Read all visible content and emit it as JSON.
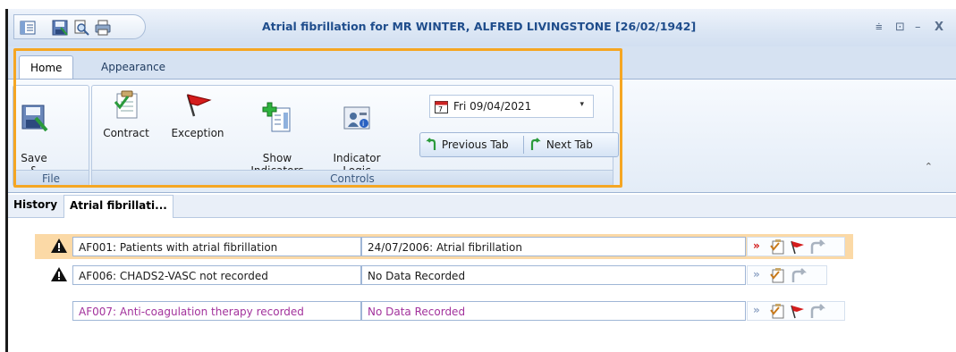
{
  "window": {
    "title": "Atrial fibrillation for MR WINTER, ALFRED LIVINGSTONE [26/02/1942]",
    "controls": [
      "⩧",
      "⊡",
      "–",
      "X"
    ]
  },
  "ribbon": {
    "tabs": [
      {
        "label": "Home",
        "active": true
      },
      {
        "label": "Appearance",
        "active": false
      }
    ],
    "groups": {
      "file": {
        "label": "File",
        "save_close": "Save &\nClose"
      },
      "controls": {
        "label": "Controls",
        "contract": "Contract",
        "exception": "Exception",
        "show_indicators": "Show\nIndicators",
        "indicator_logic": "Indicator\nLogic",
        "date_value": "Fri 09/04/2021",
        "previous_tab": "Previous Tab",
        "next_tab": "Next Tab"
      }
    },
    "collapse_glyph": "⌃"
  },
  "doc_tabs": [
    {
      "label": "History",
      "active": false
    },
    {
      "label": "Atrial fibrillati...",
      "active": true
    }
  ],
  "indicators": [
    {
      "code_label": "AF001: Patients with atrial fibrillation",
      "value": "24/07/2006: Atrial fibrillation",
      "warning": true,
      "selected": true,
      "met": false,
      "has_exception": true
    },
    {
      "code_label": "AF006: CHADS2-VASC not recorded",
      "value": "No Data Recorded",
      "warning": true,
      "selected": false,
      "met": false,
      "has_exception": false
    },
    {
      "code_label": "AF007: Anti-coagulation therapy recorded",
      "value": "No Data Recorded",
      "warning": false,
      "selected": false,
      "met": true,
      "has_exception": true
    }
  ],
  "colors": {
    "title_text": "#1f4d8c",
    "highlight": "#f5a623",
    "selected_row": "#fbd9a6",
    "purple_text": "#a2329c"
  }
}
